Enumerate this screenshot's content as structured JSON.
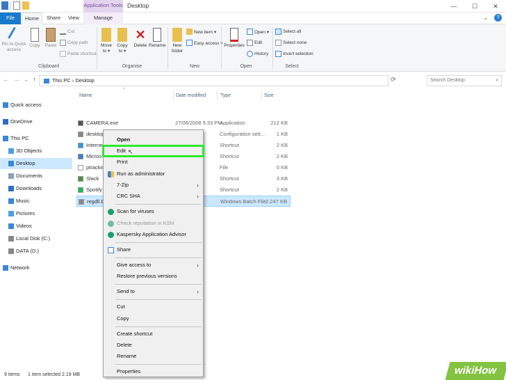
{
  "window": {
    "title": "Desktop",
    "context_tab": "Application Tools",
    "buttons": [
      "—",
      "☐",
      "✕"
    ]
  },
  "tabs": [
    "File",
    "Home",
    "Share",
    "View",
    "Manage"
  ],
  "ribbon": {
    "clipboard": {
      "pin": [
        "Pin to Quick",
        "access"
      ],
      "copy": "Copy",
      "paste": "Paste",
      "cut": "Cut",
      "copy_path": "Copy path",
      "paste_shortcut": "Paste shortcut",
      "label": "Clipboard"
    },
    "organise": {
      "move_to": [
        "Move",
        "to ▾"
      ],
      "copy_to": [
        "Copy",
        "to ▾"
      ],
      "delete": "Delete",
      "rename": "Rename",
      "label": "Organise"
    },
    "new": {
      "new_folder": [
        "New",
        "folder"
      ],
      "new_item": "New item ▾",
      "easy_access": "Easy access ▾",
      "label": "New"
    },
    "open": {
      "properties": "Properties",
      "open": "Open ▾",
      "edit": "Edit",
      "history": "History",
      "label": "Open"
    },
    "select": {
      "select_all": "Select all",
      "select_none": "Select none",
      "invert": "Invert selection",
      "label": "Select"
    }
  },
  "address": {
    "path": "This PC  ›  Desktop",
    "search_placeholder": "Search Desktop"
  },
  "nav": [
    {
      "label": "Quick access",
      "icon": "star-icon",
      "color": "#3b87d4"
    },
    {
      "label": "OneDrive",
      "icon": "cloud-icon",
      "color": "#2e6fc4"
    },
    {
      "label": "This PC",
      "icon": "computer-icon",
      "color": "#3b87d4"
    },
    {
      "label": "3D Objects",
      "icon": "cube-icon",
      "color": "#4aa0e0"
    },
    {
      "label": "Desktop",
      "icon": "desktop-icon",
      "color": "#3b87d4"
    },
    {
      "label": "Documents",
      "icon": "document-icon",
      "color": "#8aa0b8"
    },
    {
      "label": "Downloads",
      "icon": "download-icon",
      "color": "#2e6fc4"
    },
    {
      "label": "Music",
      "icon": "music-icon",
      "color": "#3b87d4"
    },
    {
      "label": "Pictures",
      "icon": "picture-icon",
      "color": "#4aa0e0"
    },
    {
      "label": "Videos",
      "icon": "video-icon",
      "color": "#3b87d4"
    },
    {
      "label": "Local Disk (C:)",
      "icon": "drive-icon",
      "color": "#888888"
    },
    {
      "label": "DATA (D:)",
      "icon": "drive-icon",
      "color": "#888888"
    },
    {
      "label": "Network",
      "icon": "network-icon",
      "color": "#3b87d4"
    }
  ],
  "columns": [
    "Name",
    "Date modified",
    "Type",
    "Size"
  ],
  "files": [
    {
      "name": "CAMERA.exe",
      "date": "27/06/2008 5:33 PM",
      "type": "Application",
      "size": "212 KB",
      "color": "#555555"
    },
    {
      "name": "desktop.",
      "date": "PM",
      "type": "Configuration sett...",
      "size": "1 KB",
      "color": "#888888"
    },
    {
      "name": "Interne",
      "date": "PM",
      "type": "Shortcut",
      "size": "2 KB",
      "color": "#2e9ae0"
    },
    {
      "name": "Micros",
      "date": "PM",
      "type": "Shortcut",
      "size": "2 KB",
      "color": "#3b7ed0"
    },
    {
      "name": "ptrackin",
      "date": "PM",
      "type": "File",
      "size": "0 KB",
      "color": "#ffffff"
    },
    {
      "name": "Slack",
      "date": "PM",
      "type": "Shortcut",
      "size": "3 KB",
      "color": "#4a8f3a"
    },
    {
      "name": "Spotify",
      "date": "PM",
      "type": "Shortcut",
      "size": "2 KB",
      "color": "#1db954"
    },
    {
      "name": "regdll.ba",
      "date": "PM",
      "type": "Windows Batch File",
      "size": "2,247 KB",
      "color": "#888888"
    }
  ],
  "context_menu": {
    "open": "Open",
    "edit": "Edit",
    "print": "Print",
    "run_as_admin": "Run as administrator",
    "zip": "7-Zip",
    "crc": "CRC SHA",
    "scan": "Scan for viruses",
    "check_rep": "Check reputation in KSN",
    "kaspersky": "Kaspersky Application Advisor",
    "share": "Share",
    "give_access": "Give access to",
    "restore": "Restore previous versions",
    "send_to": "Send to",
    "cut": "Cut",
    "copy": "Copy",
    "create_shortcut": "Create shortcut",
    "delete": "Delete",
    "rename": "Rename",
    "properties": "Properties"
  },
  "status": {
    "items": "9 items",
    "selected": "1 item selected  2.19 MB"
  },
  "watermark": "wikiHow",
  "colors": {
    "highlight": "#2ee82e",
    "file_tab": "#1979ca",
    "selection": "#cce8ff"
  }
}
